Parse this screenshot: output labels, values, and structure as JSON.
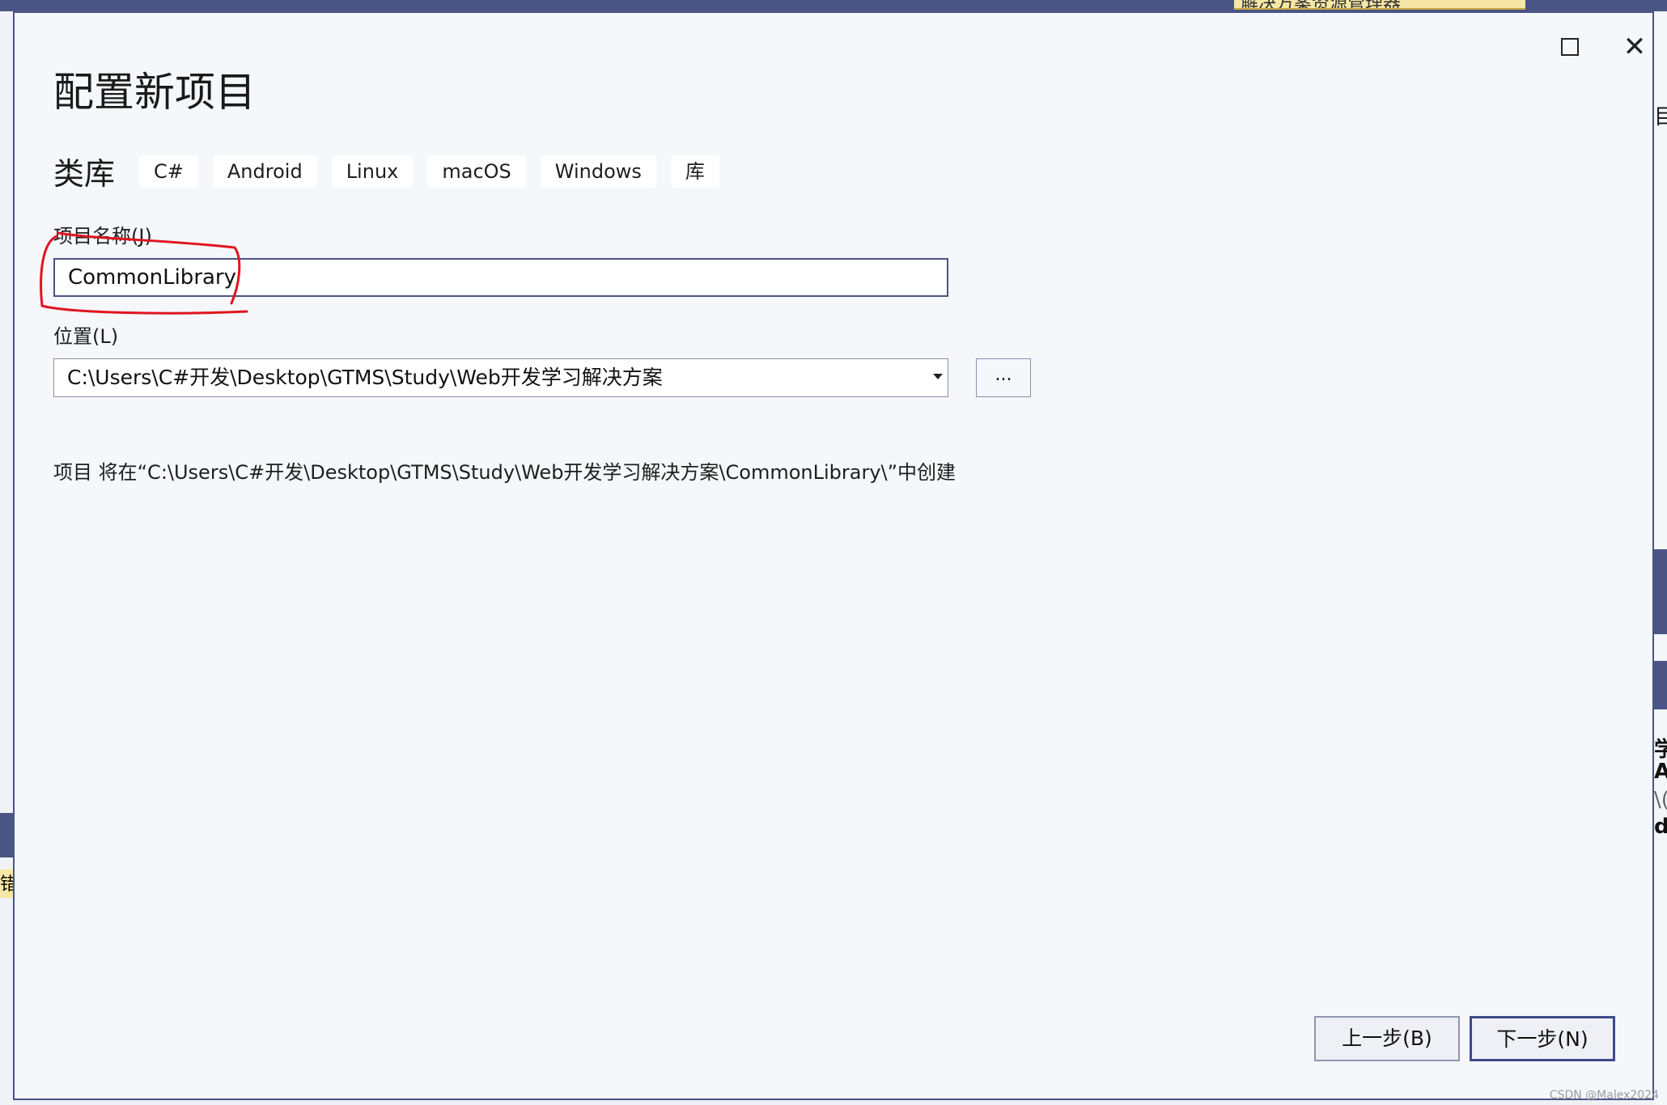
{
  "background": {
    "tab_label": "解决方案资源管理器",
    "left_snippet": "错",
    "right_snippets": [
      "目",
      "学",
      "Ar",
      "\\(",
      "dy"
    ]
  },
  "window": {
    "maximize_icon": "maximize-icon",
    "close_icon": "close-icon",
    "close_glyph": "✕"
  },
  "dialog": {
    "title": "配置新项目",
    "project_type": "类库",
    "tags": [
      "C#",
      "Android",
      "Linux",
      "macOS",
      "Windows",
      "库"
    ],
    "project_name_label": "项目名称(J)",
    "project_name_value": "CommonLibrary",
    "location_label": "位置(L)",
    "location_value": "C:\\Users\\C#开发\\Desktop\\GTMS\\Study\\Web开发学习解决方案",
    "browse_label": "...",
    "hint": "项目 将在“C:\\Users\\C#开发\\Desktop\\GTMS\\Study\\Web开发学习解决方案\\CommonLibrary\\”中创建",
    "back_button": "上一步(B)",
    "next_button": "下一步(N)"
  },
  "annotation_color": "#e0141e",
  "watermark": "CSDN @Malex2024"
}
